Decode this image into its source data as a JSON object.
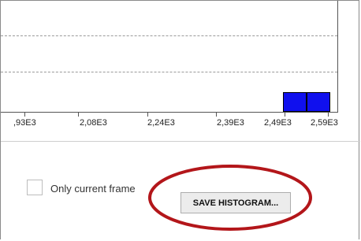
{
  "histogram": {
    "chart_data": {
      "type": "bar",
      "x_tick_labels": [
        ",93E3",
        "2,08E3",
        "2,24E3",
        "2,39E3",
        "2,49E3",
        "2,59E3"
      ],
      "bars": [
        {
          "bin_start": "2,49E3",
          "bin_end": "2,59E3",
          "visible": true
        },
        {
          "bin_start": "2,49E3",
          "bin_end": "2,59E3",
          "visible": true
        }
      ],
      "grid": true,
      "bar_color": "#1010ee"
    }
  },
  "options": {
    "only_current_frame_label": "Only current frame",
    "only_current_frame_checked": false,
    "save_histogram_label": "SAVE HISTOGRAM..."
  },
  "annotation": {
    "color": "#b3161a"
  }
}
